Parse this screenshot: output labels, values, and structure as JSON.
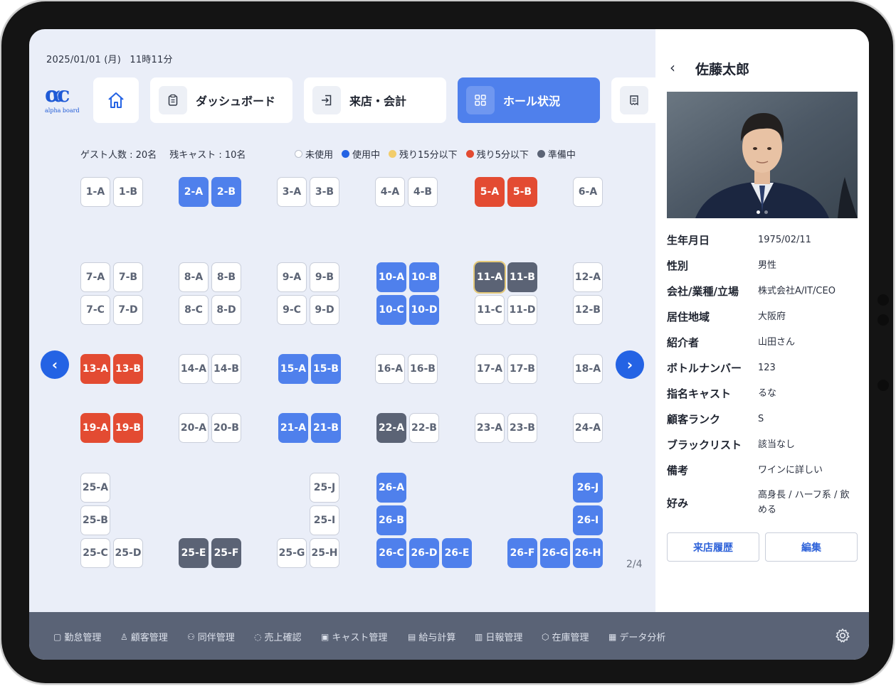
{
  "header": {
    "date": "2025/01/01 (月)",
    "time": "11時11分"
  },
  "logo": {
    "mark": "αc",
    "text": "alpha board"
  },
  "nav": [
    {
      "label": "",
      "icon": "home-icon"
    },
    {
      "label": "ダッシュボード",
      "icon": "clipboard-icon"
    },
    {
      "label": "来店・会計",
      "icon": "enter-icon"
    },
    {
      "label": "ホール状況",
      "icon": "grid-icon",
      "active": true
    },
    {
      "label": "",
      "icon": "receipt-icon"
    }
  ],
  "summary": {
    "guests": "ゲスト人数 : 20名",
    "casts": "残キャスト : 10名"
  },
  "legend": [
    {
      "label": "未使用",
      "color": "#ffffff"
    },
    {
      "label": "使用中",
      "color": "#2463e4"
    },
    {
      "label": "残り15分以下",
      "color": "#f2cd6b"
    },
    {
      "label": "残り5分以下",
      "color": "#e34b32"
    },
    {
      "label": "準備中",
      "color": "#5b6375"
    }
  ],
  "seats": {
    "s1a": "1-A",
    "s1b": "1-B",
    "s2a": "2-A",
    "s2b": "2-B",
    "s3a": "3-A",
    "s3b": "3-B",
    "s4a": "4-A",
    "s4b": "4-B",
    "s5a": "5-A",
    "s5b": "5-B",
    "s6a": "6-A",
    "s7a": "7-A",
    "s7b": "7-B",
    "s7c": "7-C",
    "s7d": "7-D",
    "s8a": "8-A",
    "s8b": "8-B",
    "s8c": "8-C",
    "s8d": "8-D",
    "s9a": "9-A",
    "s9b": "9-B",
    "s9c": "9-C",
    "s9d": "9-D",
    "s10a": "10-A",
    "s10b": "10-B",
    "s10c": "10-C",
    "s10d": "10-D",
    "s11a": "11-A",
    "s11b": "11-B",
    "s11c": "11-C",
    "s11d": "11-D",
    "s12a": "12-A",
    "s12b": "12-B",
    "s13a": "13-A",
    "s13b": "13-B",
    "s14a": "14-A",
    "s14b": "14-B",
    "s15a": "15-A",
    "s15b": "15-B",
    "s16a": "16-A",
    "s16b": "16-B",
    "s17a": "17-A",
    "s17b": "17-B",
    "s18a": "18-A",
    "s19a": "19-A",
    "s19b": "19-B",
    "s20a": "20-A",
    "s20b": "20-B",
    "s21a": "21-A",
    "s21b": "21-B",
    "s22a": "22-A",
    "s22b": "22-B",
    "s23a": "23-A",
    "s23b": "23-B",
    "s24a": "24-A",
    "s25a": "25-A",
    "s25b": "25-B",
    "s25c": "25-C",
    "s25d": "25-D",
    "s25e": "25-E",
    "s25f": "25-F",
    "s25g": "25-G",
    "s25h": "25-H",
    "s25i": "25-I",
    "s25j": "25-J",
    "s26a": "26-A",
    "s26b": "26-B",
    "s26c": "26-C",
    "s26d": "26-D",
    "s26e": "26-E",
    "s26f": "26-F",
    "s26g": "26-G",
    "s26h": "26-H",
    "s26i": "26-I",
    "s26j": "26-J"
  },
  "pager": {
    "prev": "‹",
    "next": "›",
    "page": "2/4"
  },
  "customer": {
    "back": "‹",
    "name": "佐藤太郎",
    "fields": [
      {
        "label": "生年月日",
        "value": "1975/02/11"
      },
      {
        "label": "性別",
        "value": "男性"
      },
      {
        "label": "会社/業種/立場",
        "value": "株式会社A/IT/CEO"
      },
      {
        "label": "居住地域",
        "value": "大阪府"
      },
      {
        "label": "紹介者",
        "value": "山田さん"
      },
      {
        "label": "ボトルナンバー",
        "value": "123"
      },
      {
        "label": "指名キャスト",
        "value": "るな"
      },
      {
        "label": "顧客ランク",
        "value": "S"
      },
      {
        "label": "ブラックリスト",
        "value": "該当なし"
      },
      {
        "label": "備考",
        "value": "ワインに詳しい"
      },
      {
        "label": "好み",
        "value": "高身長 / ハーフ系 / 飲める"
      }
    ],
    "history_button": "来店履歴",
    "edit_button": "編集"
  },
  "bottom_nav": [
    {
      "label": "勤怠管理",
      "icon": "calendar-icon"
    },
    {
      "label": "顧客管理",
      "icon": "user-icon"
    },
    {
      "label": "同伴管理",
      "icon": "users-icon"
    },
    {
      "label": "売上確認",
      "icon": "money-bag-icon"
    },
    {
      "label": "キャスト管理",
      "icon": "cast-icon"
    },
    {
      "label": "給与計算",
      "icon": "calculator-icon"
    },
    {
      "label": "日報管理",
      "icon": "report-icon"
    },
    {
      "label": "在庫管理",
      "icon": "box-icon"
    },
    {
      "label": "データ分析",
      "icon": "chart-icon"
    }
  ],
  "colors": {
    "accent": "#4f80ec",
    "in_use": "#4f80ec",
    "warn_red": "#e34b32",
    "prep": "#5b6375",
    "bar": "#5a6376"
  }
}
